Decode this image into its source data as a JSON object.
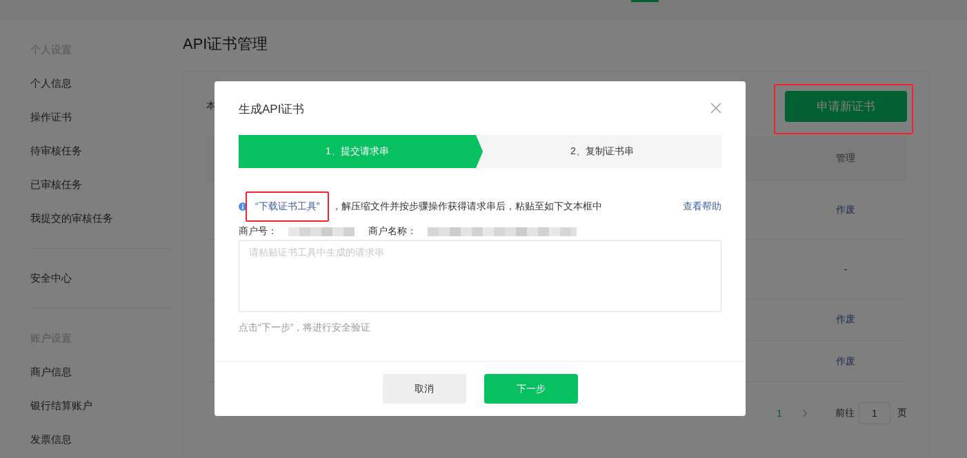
{
  "sidebar": {
    "groups": [
      {
        "heading": "个人设置",
        "items": [
          {
            "label": "个人信息",
            "selected": false
          },
          {
            "label": "操作证书",
            "selected": false
          },
          {
            "label": "待审核任务",
            "selected": false
          },
          {
            "label": "已审核任务",
            "selected": false
          },
          {
            "label": "我提交的审核任务",
            "selected": false
          }
        ]
      },
      {
        "items": [
          {
            "label": "安全中心",
            "selected": false
          }
        ]
      },
      {
        "heading": "账户设置",
        "items": [
          {
            "label": "商户信息",
            "selected": false
          },
          {
            "label": "银行结算账户",
            "selected": false
          },
          {
            "label": "发票信息",
            "selected": false
          }
        ]
      }
    ]
  },
  "page_title": "API证书管理",
  "card": {
    "intro_fragment": "本",
    "apply_button": {
      "label": "申请新证书",
      "highlighted": true
    },
    "table": {
      "columns": [
        {
          "label": "管理"
        }
      ],
      "rows": [
        {
          "action": "作废"
        },
        {
          "action": "-"
        },
        {
          "action": "作废"
        },
        {
          "action": "作废"
        }
      ]
    },
    "pagination": {
      "pages": [
        {
          "label": "1",
          "selected": true
        }
      ],
      "goto_label": "前往",
      "goto_value": "1",
      "page_suffix": "页"
    }
  },
  "dialog": {
    "title": "生成API证书",
    "steps": [
      {
        "label": "1、提交请求串",
        "selected": true
      },
      {
        "label": "2、复制证书串",
        "selected": false
      }
    ],
    "info": {
      "link": {
        "text": "“下载证书工具”",
        "highlighted": true
      },
      "text": "，解压缩文件并按步骤操作获得请求串后，粘贴至如下文本框中",
      "help_link": "查看帮助"
    },
    "merchant_fields": [
      {
        "label": "商户号："
      },
      {
        "label": "商户名称："
      }
    ],
    "request_field": {
      "placeholder": "请粘贴证书工具中生成的请求串"
    },
    "hint": "点击“下一步”，将进行安全验证",
    "buttons": [
      {
        "label": "取消",
        "kind": "secondary"
      },
      {
        "label": "下一步",
        "kind": "primary"
      }
    ]
  }
}
